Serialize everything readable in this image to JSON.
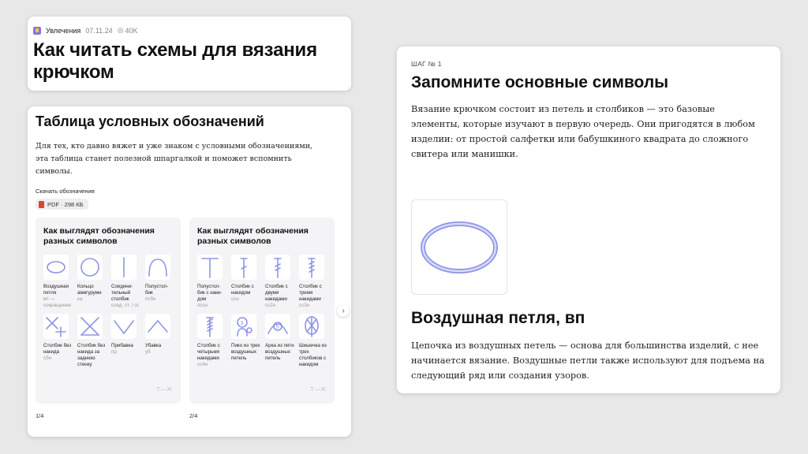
{
  "article": {
    "category": "Увлечения",
    "date": "07.11.24",
    "views": "40K",
    "title": "Как читать схемы для вязания крючком"
  },
  "table_section": {
    "heading": "Таблица условных обозначений",
    "intro": "Для тех, кто давно вяжет и уже знаком с условными обозначениями, эта таблица станет полезной шпаргалкой и поможет вспомнить символы.",
    "download_label": "Скачать обозначения",
    "file_chip": "PDF · 298 КБ"
  },
  "slides": [
    {
      "title": "Как выглядят обозначения разных символов",
      "counter": "1/4",
      "logo": "Т—Ж",
      "symbols": [
        {
          "icon": "oval",
          "name": "Воздушная петля",
          "abbr": "вп — сокращение"
        },
        {
          "icon": "circle",
          "name": "Кольцо амигуруми",
          "abbr": "ка"
        },
        {
          "icon": "vertical-line",
          "name": "Соедини-тельный столбик",
          "abbr": "соед. ст. / сс"
        },
        {
          "icon": "arch",
          "name": "Полустол-бик",
          "abbr": "псбн"
        },
        {
          "icon": "x-plus",
          "name": "Столбик без накида",
          "abbr": "сбн"
        },
        {
          "icon": "x-crossed",
          "name": "Столбик без накида за заднюю стенку",
          "abbr": ""
        },
        {
          "icon": "v-shape",
          "name": "Прибавка",
          "abbr": "пр"
        },
        {
          "icon": "caret-up",
          "name": "Убавка",
          "abbr": "уб"
        }
      ]
    },
    {
      "title": "Как выглядят обозначения разных символов",
      "counter": "2/4",
      "logo": "Т—Ж",
      "symbols": [
        {
          "icon": "t-shape",
          "name": "Полустол-бик с наки-дом",
          "abbr": "пссн"
        },
        {
          "icon": "t-one-bar",
          "name": "Столбик с накидом",
          "abbr": "ссн"
        },
        {
          "icon": "t-two-bars",
          "name": "Столбик с двумя накидами",
          "abbr": "сс2н"
        },
        {
          "icon": "t-three-bars",
          "name": "Столбик с тремя накидами",
          "abbr": "сс3н"
        },
        {
          "icon": "t-four-bars",
          "name": "Столбик с четырьмя накидами",
          "abbr": "сс4н"
        },
        {
          "icon": "picot",
          "name": "Пико из трех воздушных петель",
          "abbr": ""
        },
        {
          "icon": "arch-five",
          "name": "Арка из пяти воздушных петель",
          "abbr": ""
        },
        {
          "icon": "bobble",
          "name": "Шишечка из трех столбиков с накидом",
          "abbr": ""
        }
      ]
    }
  ],
  "step": {
    "label": "ШАГ № 1",
    "heading": "Запомните основные символы",
    "description": "Вязание крючком состоит из петель и столбиков — это базовые элементы, которые изучают в первую очередь. Они пригодятся в любом изделии: от простой салфетки или бабушкиного квадрата до сложного свитера или манишки.",
    "symbol_title": "Воздушная петля, вп",
    "symbol_description": "Цепочка из воздушных петель — основа для большинства изделий, с нее начинается вязание. Воздушные петли также используют для подъема на следующий ряд или создания узоров."
  },
  "colors": {
    "symbol_stroke": "#8e95e6",
    "symbol_fill": "#d7dafa",
    "background": "#e8e8e8",
    "pdf_icon": "#e0432b"
  }
}
